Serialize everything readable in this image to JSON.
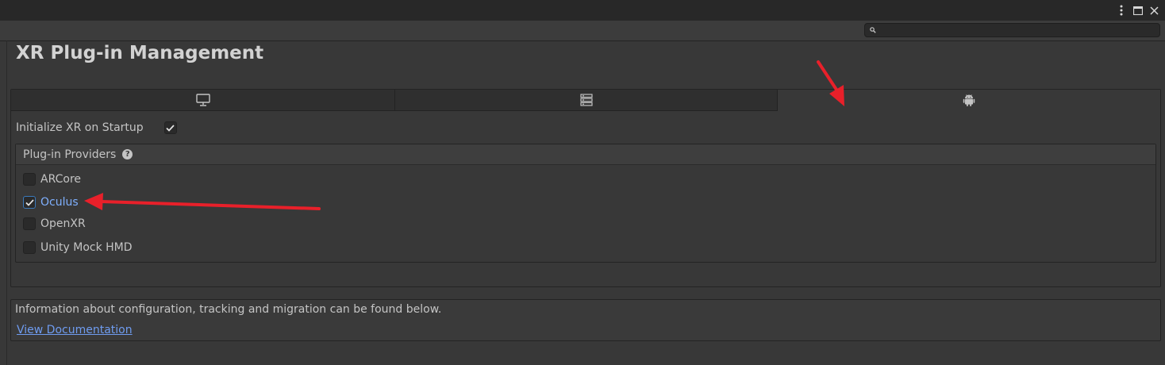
{
  "window": {
    "menu_icon": "vertical-ellipsis-icon",
    "maximize_icon": "maximize-icon",
    "close_icon": "close-icon"
  },
  "search": {
    "icon": "search-icon",
    "value": "",
    "placeholder": ""
  },
  "page": {
    "title": "XR Plug-in Management"
  },
  "tabs": [
    {
      "icon": "monitor-icon",
      "label": "",
      "active": false
    },
    {
      "icon": "server-icon",
      "label": "",
      "active": false
    },
    {
      "icon": "android-icon",
      "label": "",
      "active": true
    }
  ],
  "settings": {
    "initialize_label": "Initialize XR on Startup",
    "initialize_checked": true
  },
  "providers": {
    "header": "Plug-in Providers",
    "help_icon": "help-icon",
    "items": [
      {
        "label": "ARCore",
        "checked": false
      },
      {
        "label": "Oculus",
        "checked": true
      },
      {
        "label": "OpenXR",
        "checked": false
      },
      {
        "label": "Unity Mock HMD",
        "checked": false
      }
    ]
  },
  "info": {
    "text": "Information about configuration, tracking and migration can be found below.",
    "link": "View Documentation"
  },
  "colors": {
    "background": "#383838",
    "link": "#6f9cf0",
    "selected_provider": "#7fb0ff",
    "annotation_arrow": "#e8202a"
  }
}
